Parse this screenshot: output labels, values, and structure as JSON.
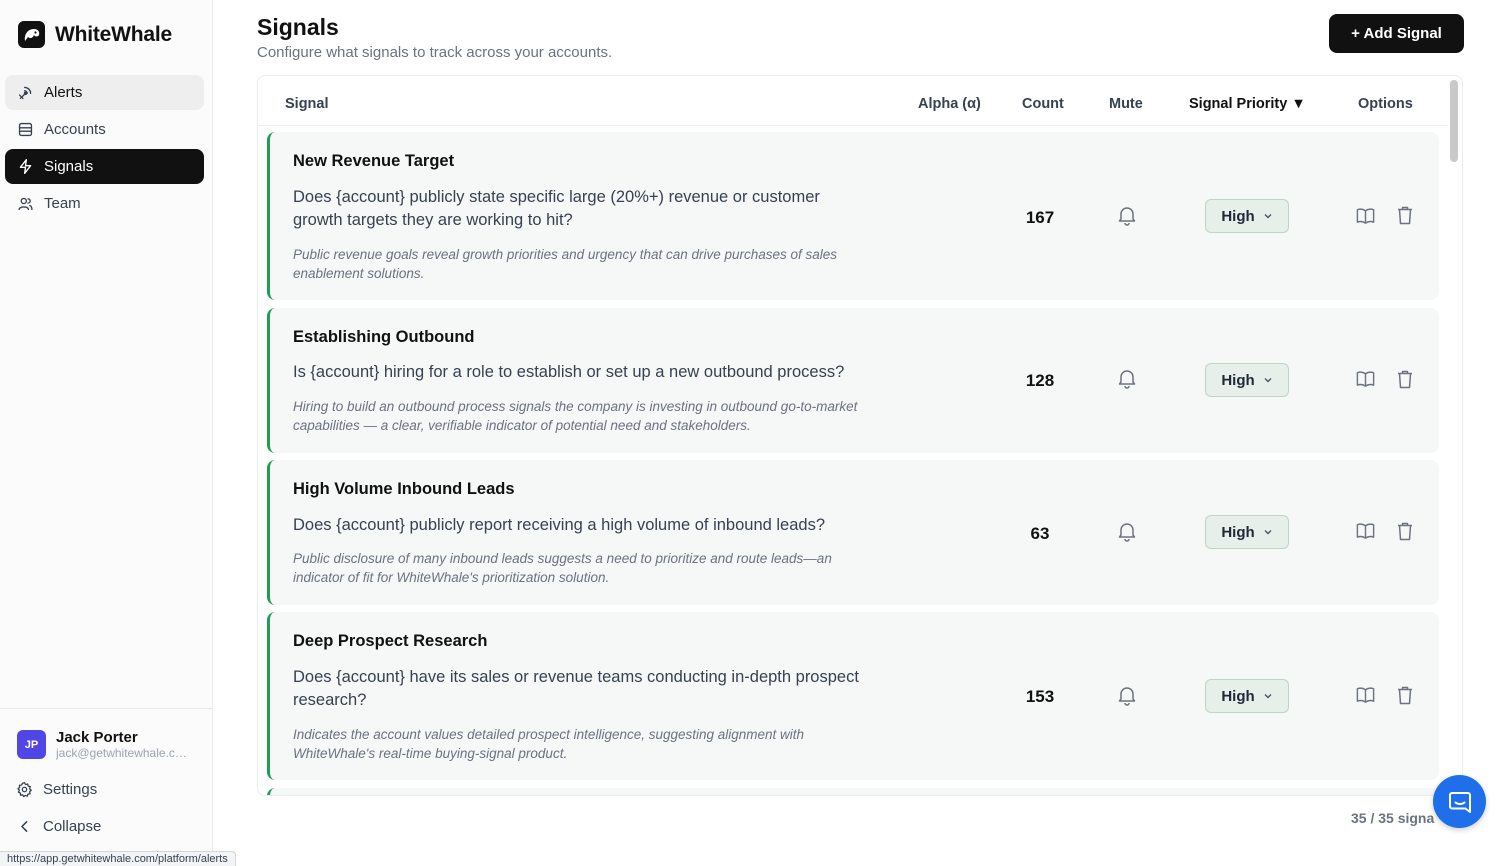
{
  "brand": {
    "name": "WhiteWhale"
  },
  "nav": [
    {
      "label": "Alerts",
      "icon": "alert-icon"
    },
    {
      "label": "Accounts",
      "icon": "accounts-icon"
    },
    {
      "label": "Signals",
      "icon": "signals-icon"
    },
    {
      "label": "Team",
      "icon": "team-icon"
    }
  ],
  "user": {
    "initials": "JP",
    "name": "Jack Porter",
    "email": "jack@getwhitewhale.com"
  },
  "side_links": {
    "settings": "Settings",
    "collapse": "Collapse"
  },
  "status_url": "https://app.getwhitewhale.com/platform/alerts",
  "page": {
    "title": "Signals",
    "subtitle": "Configure what signals to track across your accounts.",
    "add_button": "+ Add Signal"
  },
  "table": {
    "headers": {
      "signal": "Signal",
      "alpha": "Alpha (α)",
      "count": "Count",
      "mute": "Mute",
      "priority": "Signal Priority ▼",
      "options": "Options"
    },
    "rows": [
      {
        "title": "New Revenue Target",
        "question": "Does {account} publicly state specific large (20%+) revenue or customer growth targets they are working to hit?",
        "note": "Public revenue goals reveal growth priorities and urgency that can drive purchases of sales enablement solutions.",
        "count": "167",
        "priority": "High"
      },
      {
        "title": "Establishing Outbound",
        "question": "Is {account} hiring for a role to establish or set up a new outbound process?",
        "note": "Hiring to build an outbound process signals the company is investing in outbound go-to-market capabilities — a clear, verifiable indicator of potential need and stakeholders.",
        "count": "128",
        "priority": "High"
      },
      {
        "title": "High Volume Inbound Leads",
        "question": "Does {account} publicly report receiving a high volume of inbound leads?",
        "note": "Public disclosure of many inbound leads suggests a need to prioritize and route leads—an indicator of fit for WhiteWhale's prioritization solution.",
        "count": "63",
        "priority": "High"
      },
      {
        "title": "Deep Prospect Research",
        "question": "Does {account} have its sales or revenue teams conducting in-depth prospect research?",
        "note": "Indicates the account values detailed prospect intelligence, suggesting alignment with WhiteWhale's real-time buying-signal product.",
        "count": "153",
        "priority": "High"
      }
    ]
  },
  "footer": {
    "count_text": "35 / 35 signa"
  },
  "colors": {
    "accent_green": "#1f9d55",
    "primary": "#111111",
    "chat": "#1f6feb",
    "avatar": "#4f46e5"
  }
}
